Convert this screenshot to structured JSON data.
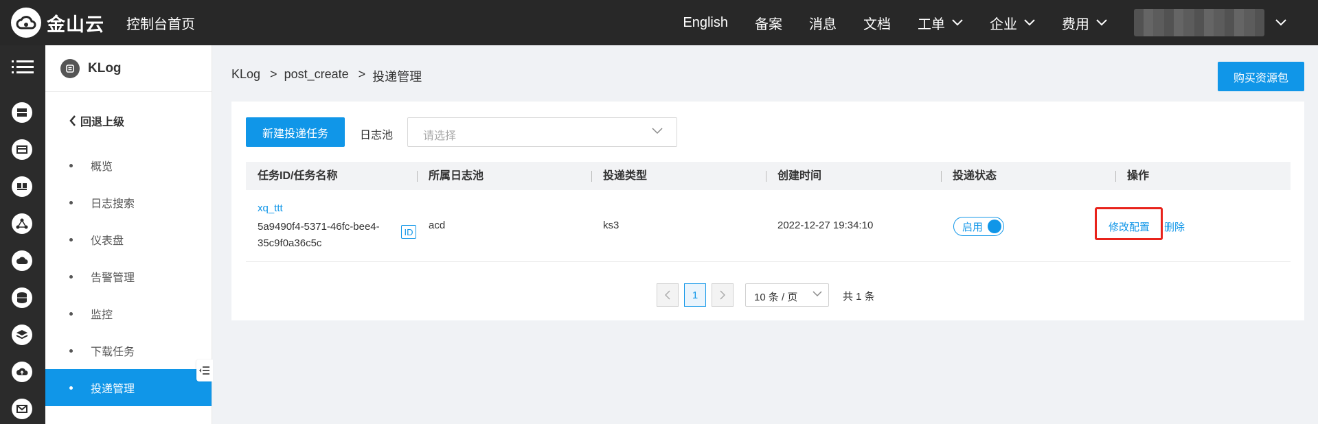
{
  "topbar": {
    "brand": "金山云",
    "console_home": "控制台首页",
    "nav": [
      {
        "label": "English",
        "dropdown": false
      },
      {
        "label": "备案",
        "dropdown": false
      },
      {
        "label": "消息",
        "dropdown": false
      },
      {
        "label": "文档",
        "dropdown": false
      },
      {
        "label": "工单",
        "dropdown": true
      },
      {
        "label": "企业",
        "dropdown": true
      },
      {
        "label": "费用",
        "dropdown": true
      }
    ]
  },
  "rail_icons": [
    "menu-icon",
    "server-icon",
    "storage-icon",
    "container-icon",
    "network-icon",
    "cloud-icon",
    "database-icon",
    "layers-icon",
    "cloud-upload-icon",
    "mail-icon"
  ],
  "sidebar": {
    "title": "KLog",
    "back": "回退上级",
    "items": [
      {
        "label": "概览",
        "active": false
      },
      {
        "label": "日志搜索",
        "active": false
      },
      {
        "label": "仪表盘",
        "active": false
      },
      {
        "label": "告警管理",
        "active": false
      },
      {
        "label": "监控",
        "active": false
      },
      {
        "label": "下载任务",
        "active": false
      },
      {
        "label": "投递管理",
        "active": true
      }
    ]
  },
  "breadcrumb": {
    "items": [
      "KLog",
      "post_create",
      "投递管理"
    ],
    "separator": ">"
  },
  "buy_button": "购买资源包",
  "toolbar": {
    "new_task": "新建投递任务",
    "pool_label": "日志池",
    "pool_placeholder": "请选择"
  },
  "table": {
    "headers": [
      "任务ID/任务名称",
      "所属日志池",
      "投递类型",
      "创建时间",
      "投递状态",
      "操作"
    ],
    "rows": [
      {
        "task_name": "xq_ttt",
        "task_id_line1": "5a9490f4-5371-46fc-bee4-",
        "task_id_line2": "35c9f0a36c5c",
        "id_badge": "ID",
        "pool": "acd",
        "type": "ks3",
        "created": "2022-12-27 19:34:10",
        "status": "启用",
        "status_on": true,
        "op_edit": "修改配置",
        "op_delete": "删除"
      }
    ]
  },
  "pagination": {
    "current_page": "1",
    "page_size": "10 条 / 页",
    "total": "共 1 条"
  },
  "colors": {
    "accent": "#1096e8",
    "topbar": "#282828",
    "highlight": "#e8231b"
  }
}
